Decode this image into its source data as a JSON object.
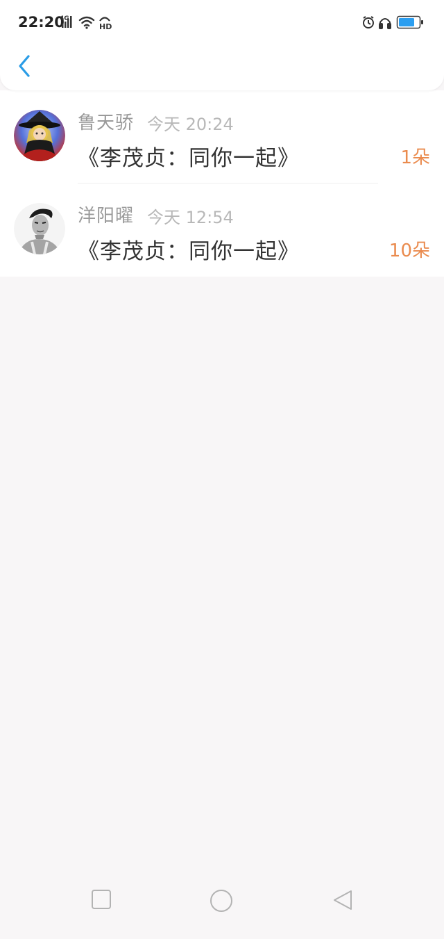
{
  "status_bar": {
    "time": "22:20",
    "network": "4G",
    "hd_label": "HD",
    "icons": [
      "signal-icon",
      "wifi-icon",
      "alarm-icon",
      "headphones-icon",
      "battery-icon"
    ],
    "accent": "#2b9ef0"
  },
  "header": {
    "back_icon": "chevron-left-icon",
    "back_color": "#2a9ce6"
  },
  "list": [
    {
      "name": "鲁天骄",
      "time": "今天 20:24",
      "title": "《李茂贞：同你一起》",
      "count": "1朵"
    },
    {
      "name": "洋阳曜",
      "time": "今天 12:54",
      "title": "《李茂贞：同你一起》",
      "count": "10朵"
    }
  ],
  "colors": {
    "count": "#ea8b4e",
    "name": "#9a9a9a",
    "title": "#333333"
  },
  "navbar": {
    "icons": [
      "square-icon",
      "circle-icon",
      "triangle-back-icon"
    ]
  }
}
